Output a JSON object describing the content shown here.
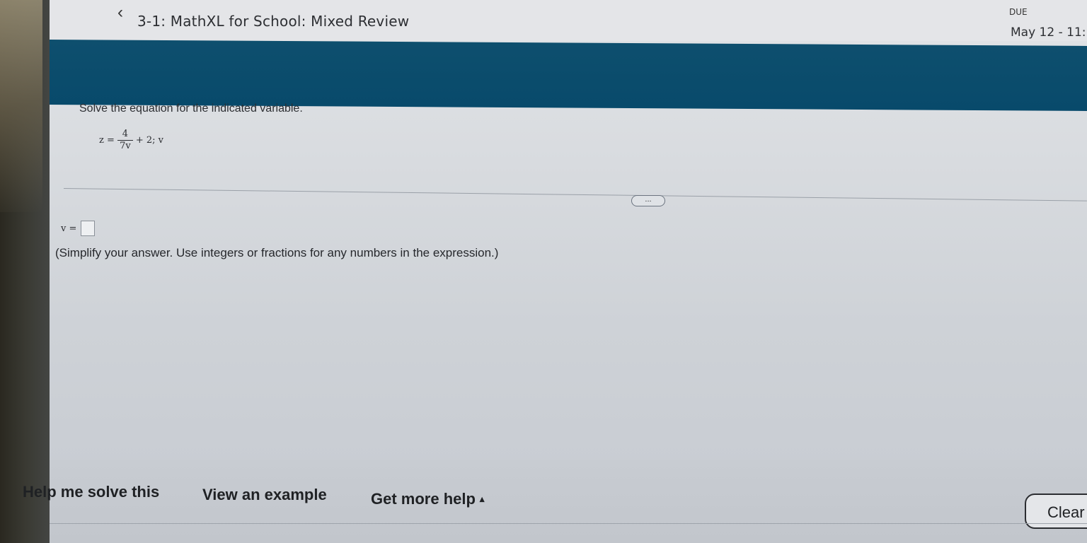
{
  "header": {
    "back_icon": "chevron-left-icon",
    "title": "3-1: MathXL for School: Mixed Review",
    "due_label": "DUE",
    "due_date": "May 12 - 11:"
  },
  "question": {
    "prompt": "Solve the equation for the indicated variable.",
    "equation": {
      "lhs": "z =",
      "numerator": "4",
      "denominator": "7v",
      "rest": "+ 2; v"
    },
    "more_button": "...",
    "answer_label": "v =",
    "instruction": "(Simplify your answer. Use integers or fractions for any numbers in the expression.)"
  },
  "help": {
    "solve": "Help me solve this",
    "example": "View an example",
    "more": "Get more help",
    "more_caret": "▴",
    "clear": "Clear"
  },
  "colors": {
    "banner": "#0e4f6e"
  }
}
